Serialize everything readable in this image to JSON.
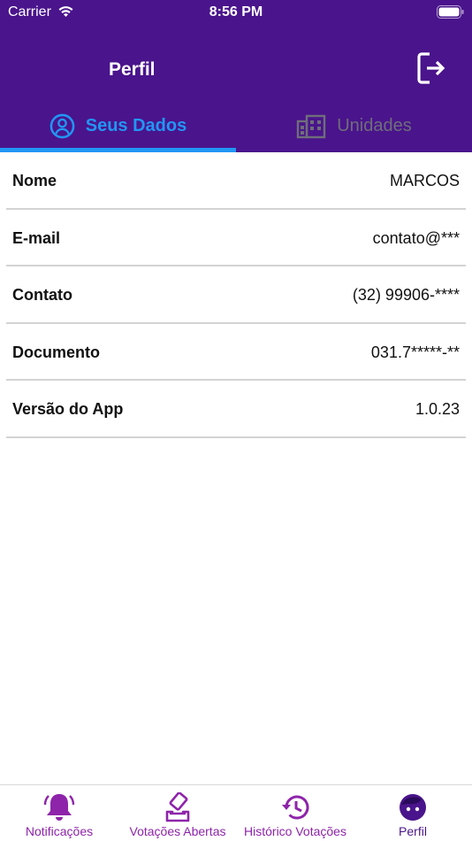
{
  "status_bar": {
    "carrier": "Carrier",
    "time": "8:56 PM"
  },
  "header": {
    "title": "Perfil",
    "logout_icon": "logout-icon"
  },
  "tabs": [
    {
      "label": "Seus Dados",
      "icon": "user-circle-icon",
      "active": true
    },
    {
      "label": "Unidades",
      "icon": "building-icon",
      "active": false
    }
  ],
  "profile_rows": [
    {
      "label": "Nome",
      "value": "MARCOS"
    },
    {
      "label": "E-mail",
      "value": "contato@***"
    },
    {
      "label": "Contato",
      "value": "(32) 99906-****"
    },
    {
      "label": "Documento",
      "value": "031.7*****-**"
    },
    {
      "label": "Versão do App",
      "value": "1.0.23"
    }
  ],
  "bottom_nav": [
    {
      "label": "Notificações",
      "icon": "bell-icon"
    },
    {
      "label": "Votações Abertas",
      "icon": "ballot-icon"
    },
    {
      "label": "Histórico Votações",
      "icon": "history-icon"
    },
    {
      "label": "Perfil",
      "icon": "profile-face-icon",
      "active": true
    }
  ],
  "colors": {
    "header": "#4a148c",
    "active_tab": "#2196f3",
    "inactive_tab": "#6e6e7a",
    "nav_icon": "#8e24aa",
    "nav_active": "#4a148c"
  }
}
